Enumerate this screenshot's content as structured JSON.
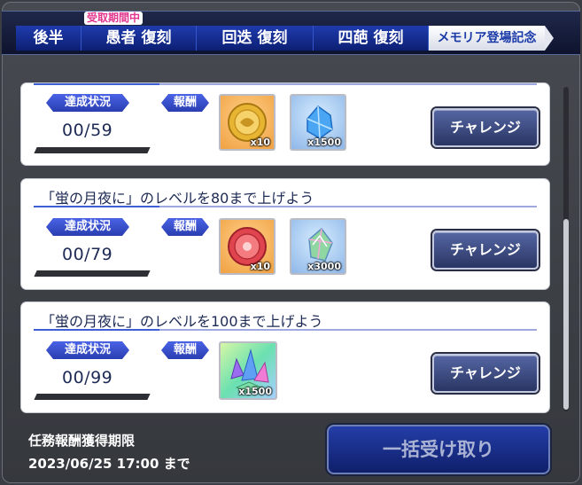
{
  "tabs": [
    {
      "label": "後半",
      "pill": ""
    },
    {
      "label": "愚者 復刻",
      "pill": "受取期間中"
    },
    {
      "label": "回迭 復刻",
      "pill": ""
    },
    {
      "label": "四葩 復刻",
      "pill": ""
    },
    {
      "label": "メモリア登場記念",
      "pill": ""
    }
  ],
  "labels": {
    "status": "達成状況",
    "reward": "報酬",
    "challenge": "チャレンジ"
  },
  "missions": [
    {
      "title": "",
      "progress": "00/59",
      "progress_fraction": 0,
      "rewards": [
        {
          "icon": "gold-coin-icon",
          "qty": "x10"
        },
        {
          "icon": "blue-crystal-icon",
          "qty": "x1500"
        }
      ]
    },
    {
      "title": "「蛍の月夜に」のレベルを80まで上げよう",
      "progress": "00/79",
      "progress_fraction": 0,
      "rewards": [
        {
          "icon": "red-coin-icon",
          "qty": "x10"
        },
        {
          "icon": "rainbow-gem-icon",
          "qty": "x3000"
        }
      ]
    },
    {
      "title": "「蛍の月夜に」のレベルを100まで上げよう",
      "progress": "00/99",
      "progress_fraction": 0,
      "rewards": [
        {
          "icon": "rainbow-crystal-icon",
          "qty": "x1500"
        }
      ]
    }
  ],
  "footer": {
    "deadline_label": "任務報酬獲得期限",
    "deadline_date": "2023/06/25 17:00 まで",
    "claim_all": "一括受け取り"
  },
  "colors": {
    "accent": "#2a3eb0",
    "progress_fill": "#4fd06b",
    "pill_text": "#e2348c"
  }
}
